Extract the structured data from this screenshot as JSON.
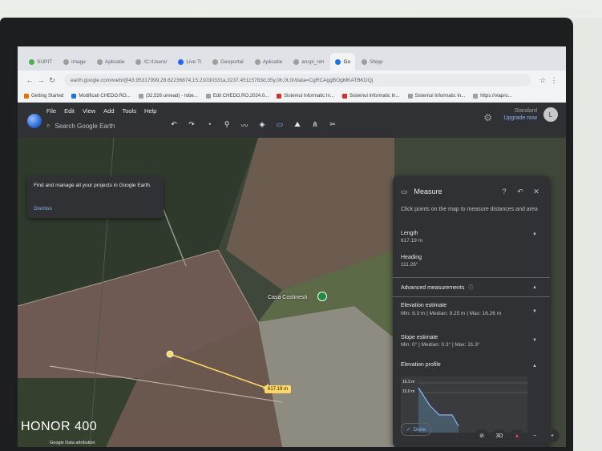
{
  "browser": {
    "tabs": [
      {
        "label": "SUPIT",
        "color": "#4caf50",
        "active": false
      },
      {
        "label": "image",
        "color": "#9e9e9e",
        "active": false
      },
      {
        "label": "Aplicatie",
        "color": "#9e9e9e",
        "active": false
      },
      {
        "label": "/C:/Users/",
        "color": "#9e9e9e",
        "active": false
      },
      {
        "label": "Live Ti",
        "color": "#2962ff",
        "active": false
      },
      {
        "label": "Geoportal",
        "color": "#9e9e9e",
        "active": false
      },
      {
        "label": "Aplicatie",
        "color": "#9e9e9e",
        "active": false
      },
      {
        "label": "ancpi_nm",
        "color": "#9e9e9e",
        "active": false
      },
      {
        "label": "Go",
        "color": "#1a73e8",
        "active": true
      },
      {
        "label": "Shipp",
        "color": "#9e9e9e",
        "active": false
      }
    ],
    "url": "earth.google.com/web/@43.95317999,28.62236874,15.21030331a,3237.45115783d,35y,0h,0t,0r/data=CgRCAggBOgMKATBKDQj",
    "bookmarks": [
      {
        "label": "Getting Started",
        "color": "#e8710a"
      },
      {
        "label": "Modificati CHEDO.RO...",
        "color": "#1a73e8"
      },
      {
        "label": "(32,526 unread) - robe...",
        "color": "#9e9e9e"
      },
      {
        "label": "Edit CHEDO.RO.2024.0...",
        "color": "#9e9e9e"
      },
      {
        "label": "Sistemul Informatic In...",
        "color": "#d93025"
      },
      {
        "label": "Sistemul Informatic In...",
        "color": "#d93025"
      },
      {
        "label": "Sistemul Informatic In...",
        "color": "#9e9e9e"
      },
      {
        "label": "https://viapro...",
        "color": "#9e9e9e"
      }
    ]
  },
  "earth": {
    "menus": [
      "File",
      "Edit",
      "View",
      "Add",
      "Tools",
      "Help"
    ],
    "search_placeholder": "Search Google Earth",
    "account_line1": "Standard",
    "account_line2": "Upgrade now",
    "avatar_letter": "L",
    "tip_text": "Find and manage all your projects in Google Earth.",
    "tip_dismiss": "Dismiss",
    "place_label": "Casa Costinesti",
    "distance_label": "617.19 m",
    "attribution": "Google     Data attribution"
  },
  "measure": {
    "title": "Measure",
    "instructions": "Click points on the map to measure distances and area",
    "length_label": "Length",
    "length_value": "617.19 m",
    "heading_label": "Heading",
    "heading_value": "111.26°",
    "advanced_label": "Advanced measurements",
    "elevation_label": "Elevation estimate",
    "elevation_value": "Min: 8.3 m | Median: 9.25 m | Max: 16.26 m",
    "slope_label": "Slope estimate",
    "slope_value": "Min: 0° | Median: 0.3° | Max: 31.3°",
    "profile_label": "Elevation profile",
    "profile_tick_high": "16.3 m",
    "profile_tick_low": "15.0 m",
    "done_label": "Done"
  },
  "map_controls": {
    "view_3d": "3D"
  },
  "watermark": "HONOR 400"
}
